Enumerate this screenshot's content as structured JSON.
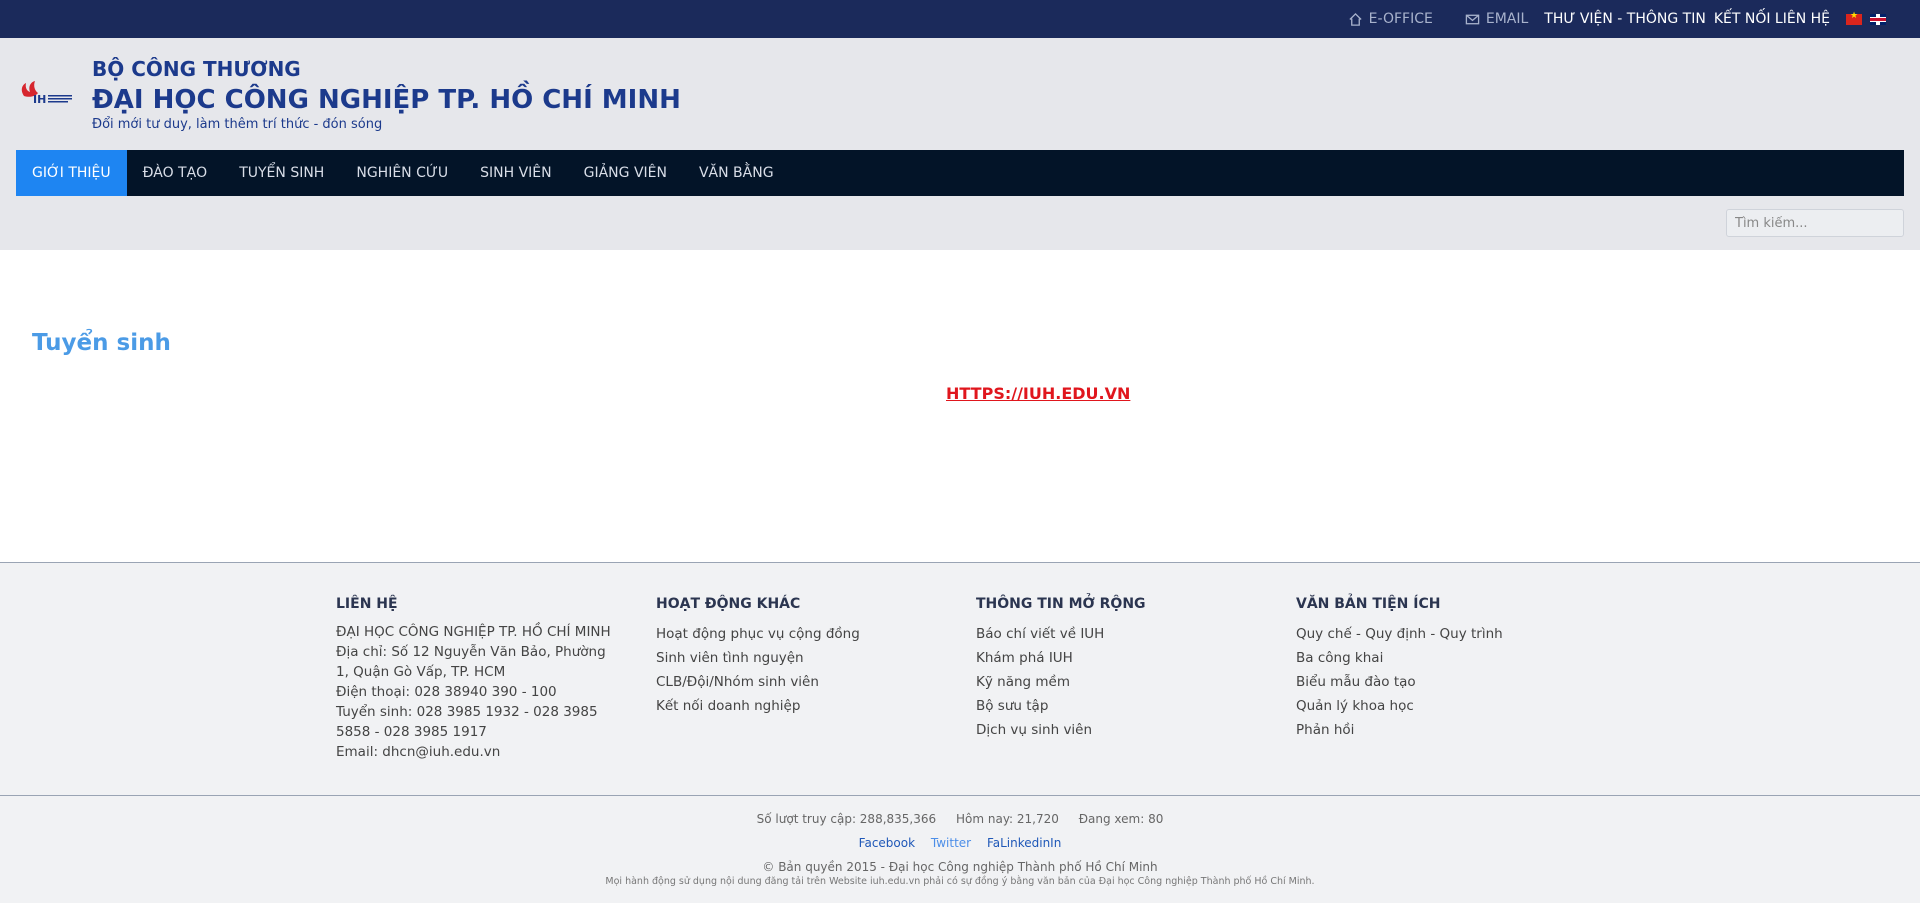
{
  "topbar": {
    "eoffice": "E-OFFICE",
    "email": "EMAIL",
    "library": "THƯ VIỆN - THÔNG TIN",
    "connect": "KẾT NỐI LIÊN HỆ"
  },
  "header": {
    "ministry": "BỘ CÔNG THƯƠNG",
    "university": "ĐẠI HỌC CÔNG NGHIỆP TP. HỒ CHÍ MINH",
    "slogan": "Đổi mới tư duy, làm thêm trí thức - đón sóng"
  },
  "nav": {
    "items": [
      {
        "label": "GIỚI THIỆU"
      },
      {
        "label": "ĐÀO TẠO"
      },
      {
        "label": "TUYỂN SINH"
      },
      {
        "label": "NGHIÊN CỨU"
      },
      {
        "label": "SINH VIÊN"
      },
      {
        "label": "GIẢNG VIÊN"
      },
      {
        "label": "VĂN BẰNG"
      }
    ],
    "active_index": 0
  },
  "search": {
    "placeholder": "Tìm kiếm..."
  },
  "main": {
    "title": "Tuyển sinh",
    "link": "HTTPS://IUH.EDU.VN"
  },
  "footer": {
    "contact": {
      "heading": "LIÊN HỆ",
      "name": "ĐẠI HỌC CÔNG NGHIỆP TP. HỒ CHÍ MINH",
      "address": "Địa chỉ: Số 12 Nguyễn Văn Bảo, Phường 1, Quận Gò Vấp, TP. HCM",
      "phone": "Điện thoại: 028 38940 390 - 100",
      "admission": "Tuyển sinh: 028 3985 1932 - 028 3985 5858 - 028 3985 1917",
      "email": "Email: dhcn@iuh.edu.vn"
    },
    "other": {
      "heading": "HOẠT ĐỘNG KHÁC",
      "items": [
        "Hoạt động phục vụ cộng đồng",
        "Sinh viên tình nguyện",
        "CLB/Đội/Nhóm sinh viên",
        "Kết nối doanh nghiệp"
      ]
    },
    "info": {
      "heading": "THÔNG TIN MỞ RỘNG",
      "items": [
        "Báo chí viết về IUH",
        "Khám phá IUH",
        "Kỹ năng mềm",
        "Bộ sưu tập",
        "Dịch vụ sinh viên"
      ]
    },
    "docs": {
      "heading": "VĂN BẢN TIỆN ÍCH",
      "items": [
        "Quy chế - Quy định - Quy trình",
        "Ba công khai",
        "Biểu mẫu đào tạo",
        "Quản lý khoa học",
        "Phản hồi"
      ]
    }
  },
  "bottom": {
    "visits": "Số lượt truy cập: 288,835,366",
    "today": "Hôm nay: 21,720",
    "online": "Đang xem: 80",
    "facebook": "Facebook",
    "twitter": "Twitter",
    "linkedin": "FaLinkedinIn",
    "copyright": "© Bản quyền 2015 - Đại học Công nghiệp Thành phố Hồ Chí Minh",
    "notice": "Mọi hành động sử dụng nội dung đăng tải trên Website iuh.edu.vn phải có sự đồng ý bằng văn bản của Đại học Công nghiệp Thành phố Hồ Chí Minh."
  }
}
